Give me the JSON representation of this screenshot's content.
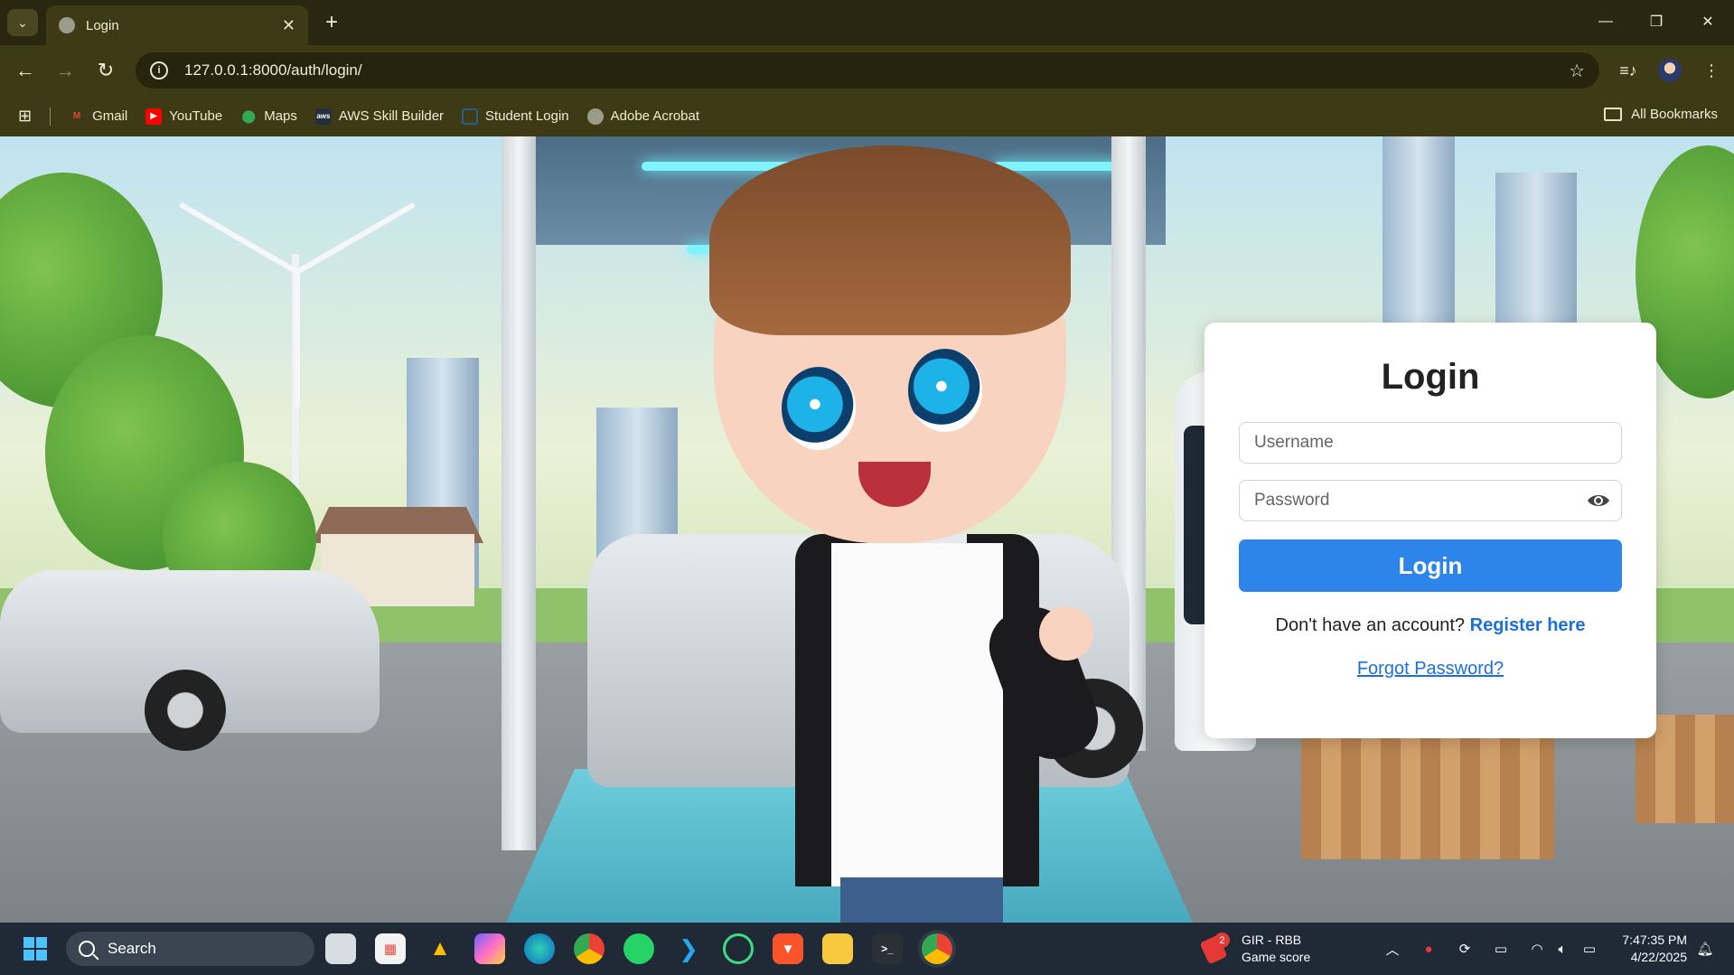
{
  "browser": {
    "tab_title": "Login",
    "url": "127.0.0.1:8000/auth/login/",
    "bookmarks": [
      {
        "label": "Gmail",
        "icon": "gmail-icon",
        "color": "#ea4335"
      },
      {
        "label": "YouTube",
        "icon": "youtube-icon",
        "color": "#ff0000"
      },
      {
        "label": "Maps",
        "icon": "maps-icon",
        "color": "#34a853"
      },
      {
        "label": "AWS Skill Builder",
        "icon": "aws-icon",
        "color": "#232f3e"
      },
      {
        "label": "Student Login",
        "icon": "student-login-icon",
        "color": "#2b5d8a"
      },
      {
        "label": "Adobe Acrobat",
        "icon": "globe-icon",
        "color": "#9b9b8a"
      }
    ],
    "all_bookmarks": "All Bookmarks"
  },
  "login": {
    "title": "Login",
    "username_placeholder": "Username",
    "password_placeholder": "Password",
    "button": "Login",
    "no_account": "Don't have an account?",
    "register": "Register here",
    "forgot": "Forgot Password?"
  },
  "colors": {
    "accent": "#2d85e9",
    "link": "#1d6fd8",
    "chrome_frame": "#3d3a15"
  },
  "taskbar": {
    "search": "Search",
    "game_title": "GIR - RBB",
    "game_subtitle": "Game score",
    "game_badge": "2",
    "time": "7:47:35 PM",
    "date": "4/22/2025"
  }
}
